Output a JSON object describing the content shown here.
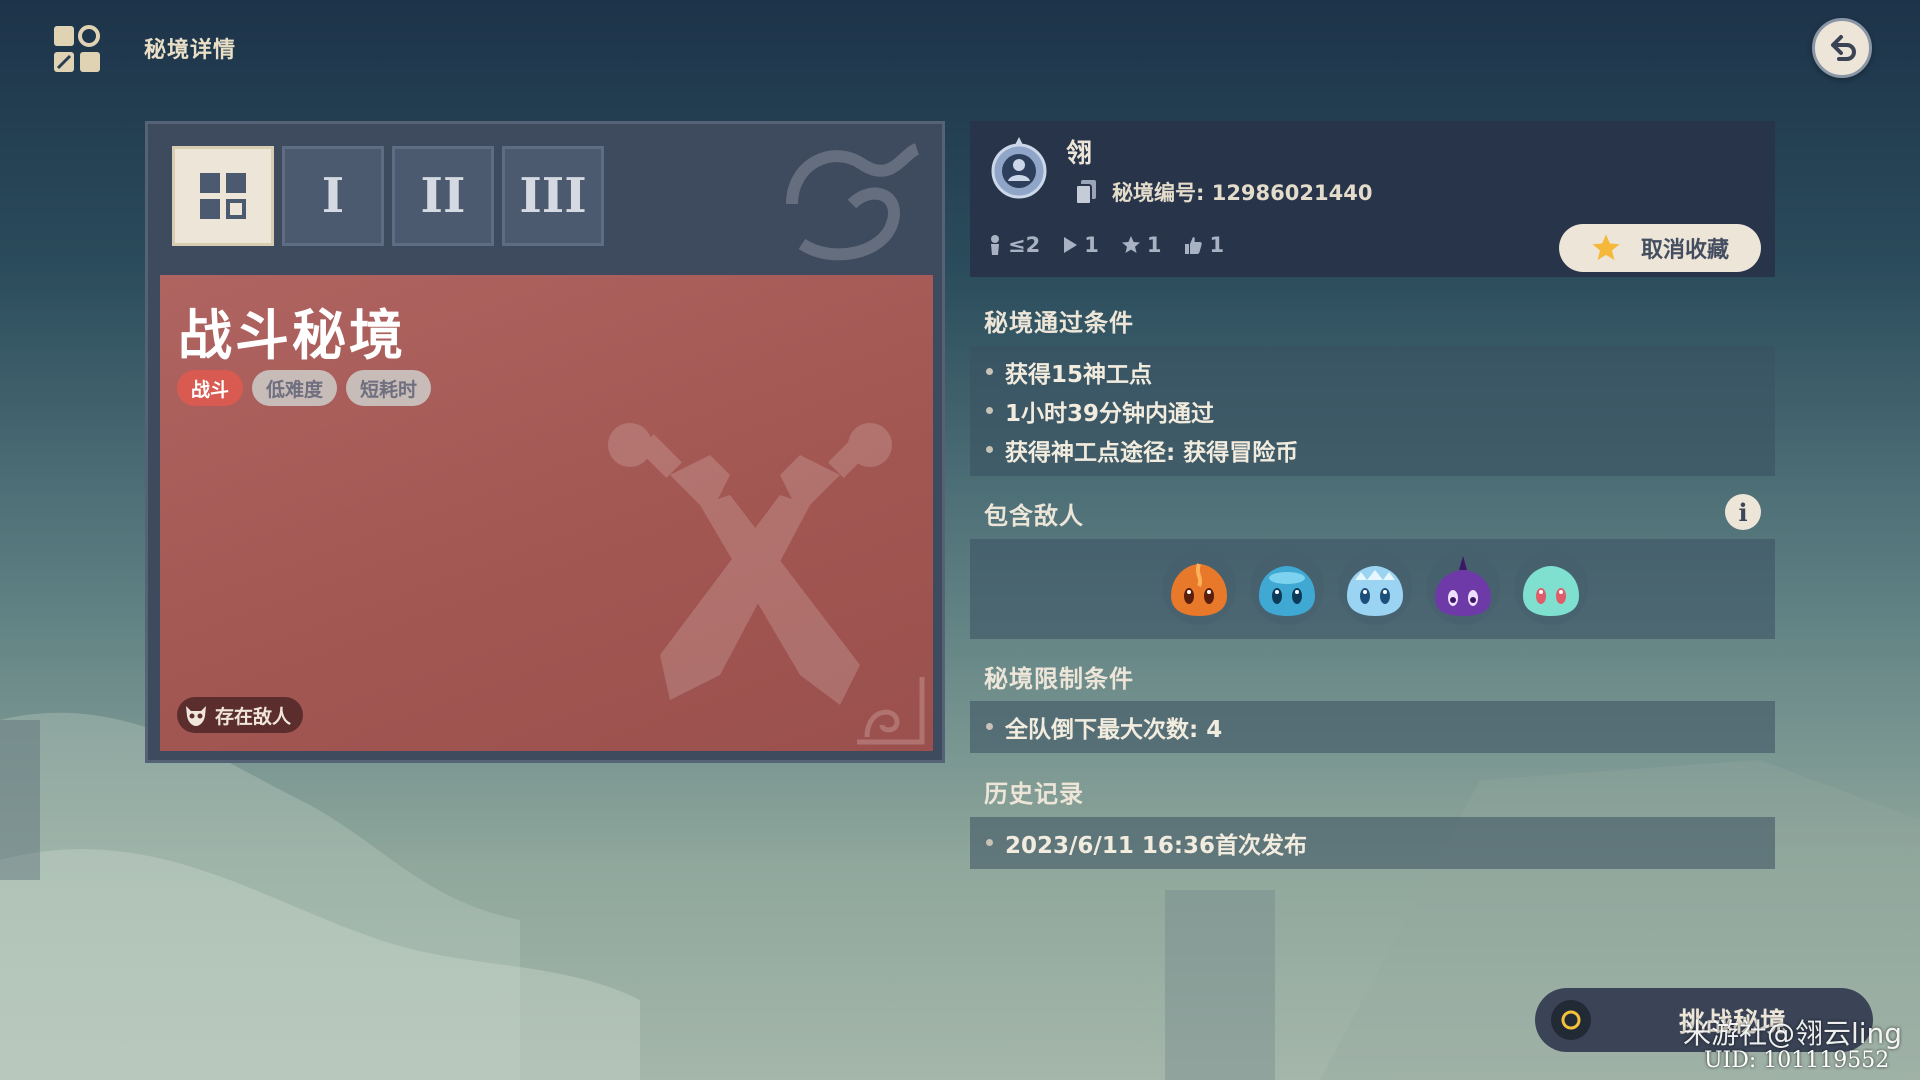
{
  "header": {
    "title": "秘境详情"
  },
  "tabs": [
    {
      "label": ""
    },
    {
      "label": "I"
    },
    {
      "label": "II"
    },
    {
      "label": "III"
    }
  ],
  "card": {
    "title": "战斗秘境",
    "tags": [
      "战斗",
      "低难度",
      "短耗时"
    ],
    "enemy_badge": "存在敌人"
  },
  "info": {
    "author": "翎",
    "code_label": "秘境编号: 12986021440",
    "stats": {
      "players": "≤2",
      "plays": "1",
      "favorites": "1",
      "likes": "1"
    },
    "unfavorite_label": "取消收藏"
  },
  "pass_conditions": {
    "title": "秘境通过条件",
    "items": [
      "获得15神工点",
      "1小时39分钟内通过",
      "获得神工点途径: 获得冒险币"
    ]
  },
  "enemies": {
    "title": "包含敌人",
    "info_label": "i",
    "icons": [
      "pyro-slime-icon",
      "hydro-slime-icon",
      "cryo-slime-icon",
      "electro-slime-icon",
      "anemo-slime-icon"
    ]
  },
  "restrictions": {
    "title": "秘境限制条件",
    "items": [
      "全队倒下最大次数: 4"
    ]
  },
  "history": {
    "title": "历史记录",
    "items": [
      "2023/6/11 16:36首次发布"
    ]
  },
  "footer": {
    "challenge_label": "挑战秘境",
    "watermark": "米游社@翎云ling",
    "uid": "UID: 101119552"
  },
  "colors": {
    "card_red": "#a35753",
    "tag_red": "#d95a50",
    "panel_dark": "#27344a",
    "cream": "#ece5d8"
  }
}
